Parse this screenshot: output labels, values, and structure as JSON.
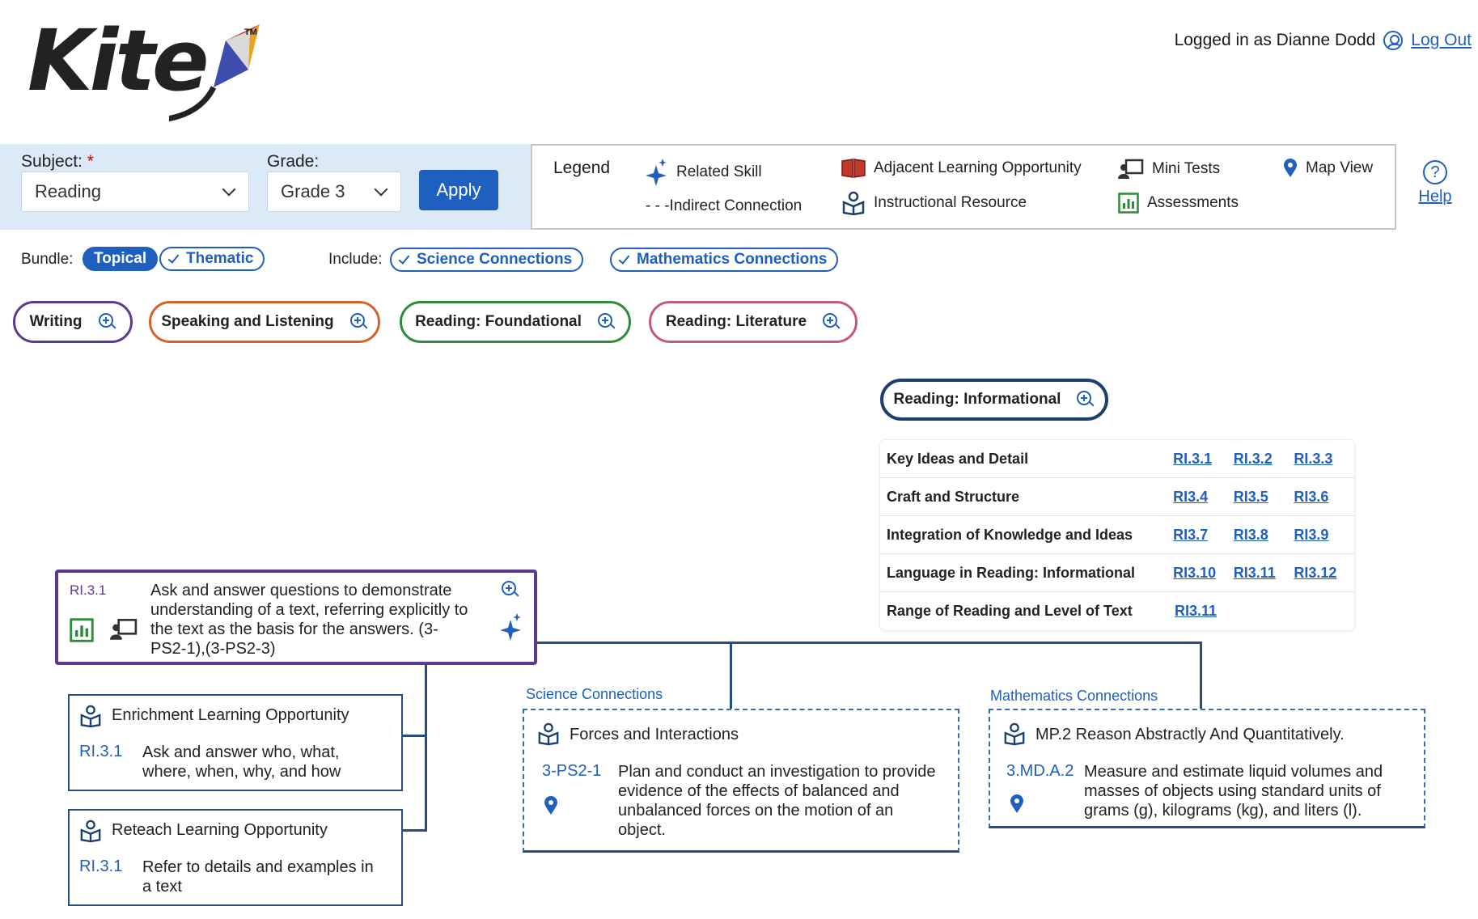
{
  "header": {
    "logo_text": "Kite",
    "logo_tm": "TM",
    "logged_in_text": "Logged in as Dianne Dodd",
    "logout_label": "Log Out"
  },
  "filters": {
    "subject_label": "Subject:",
    "required_mark": "*",
    "subject_value": "Reading",
    "grade_label": "Grade:",
    "grade_value": "Grade 3",
    "apply_label": "Apply"
  },
  "legend": {
    "title": "Legend",
    "related_skill": "Related Skill",
    "indirect_connection": "- - -Indirect Connection",
    "adjacent_learning": "Adjacent Learning Opportunity",
    "instructional_resource": "Instructional Resource",
    "mini_tests": "Mini Tests",
    "assessments": "Assessments",
    "map_view": "Map View"
  },
  "help_label": "Help",
  "bundle": {
    "label": "Bundle:",
    "topical": "Topical",
    "thematic": "Thematic"
  },
  "include": {
    "label": "Include:",
    "science": "Science Connections",
    "mathematics": "Mathematics Connections"
  },
  "strands": {
    "writing": "Writing",
    "speaking": "Speaking and Listening",
    "foundational": "Reading: Foundational",
    "literature": "Reading: Literature",
    "informational": "Reading: Informational"
  },
  "standards_table": [
    {
      "category": "Key Ideas and Detail",
      "codes": [
        "RI.3.1",
        "RI.3.2",
        "RI.3.3"
      ]
    },
    {
      "category": "Craft and Structure",
      "codes": [
        "RI3.4",
        "RI3.5",
        "RI3.6"
      ]
    },
    {
      "category": "Integration of Knowledge and Ideas",
      "codes": [
        "RI3.7",
        "RI3.8",
        "RI3.9"
      ]
    },
    {
      "category": "Language in Reading: Informational",
      "codes": [
        "RI3.10",
        "RI3.11",
        "RI3.12"
      ]
    },
    {
      "category": "Range of Reading and Level of Text",
      "codes": [
        "RI3.11"
      ]
    }
  ],
  "main_standard": {
    "code": "RI.3.1",
    "text": "Ask and answer questions to demonstrate understanding of a text, referring explicitly to the text as the basis for the answers. (3-PS2-1),(3-PS2-3)"
  },
  "enrichment": {
    "title": "Enrichment Learning Opportunity",
    "code": "RI.3.1",
    "text": "Ask and answer who, what, where, when, why, and how"
  },
  "reteach": {
    "title": "Reteach Learning Opportunity",
    "code": "RI.3.1",
    "text": "Refer to details and examples in a text"
  },
  "science": {
    "section_label": "Science Connections",
    "title": "Forces and Interactions",
    "code": "3-PS2-1",
    "text": "Plan and conduct an investigation to provide evidence of the effects of balanced and unbalanced forces on the motion of an object."
  },
  "mathematics": {
    "section_label": "Mathematics Connections",
    "title": "MP.2 Reason Abstractly And Quantitatively.",
    "code": "3.MD.A.2",
    "text": "Measure and estimate liquid volumes and masses of objects using standard units of grams (g), kilograms (kg), and liters (l)."
  },
  "colors": {
    "brand_blue": "#1f5fbf",
    "writing": "#5c3a8e",
    "speaking": "#d4622b",
    "foundational": "#2e8b3a",
    "literature": "#c45a78",
    "informational": "#1b3f6e"
  }
}
